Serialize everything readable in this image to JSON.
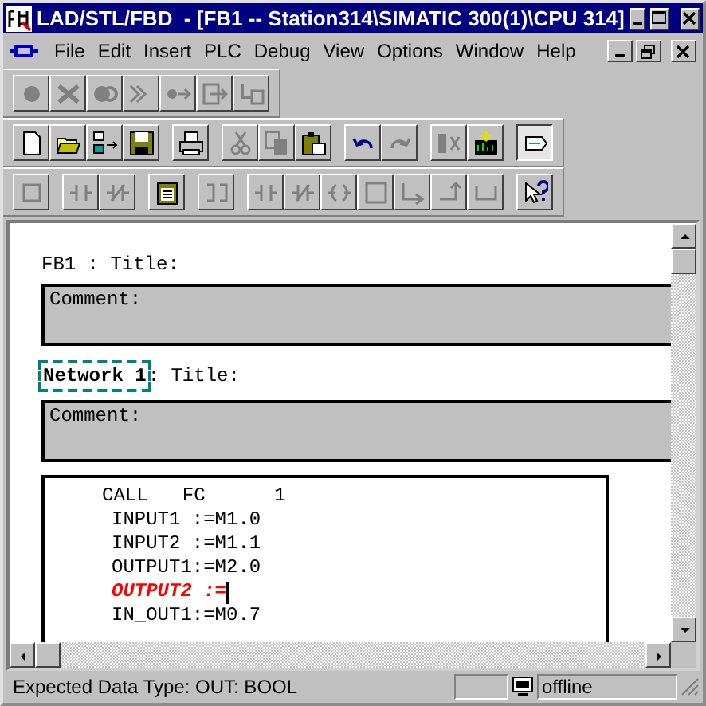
{
  "window": {
    "title": "LAD/STL/FBD  - [FB1 -- Station314\\SIMATIC 300(1)\\CPU 314]"
  },
  "menu": [
    {
      "label": "File"
    },
    {
      "label": "Edit"
    },
    {
      "label": "Insert"
    },
    {
      "label": "PLC"
    },
    {
      "label": "Debug"
    },
    {
      "label": "View"
    },
    {
      "label": "Options"
    },
    {
      "label": "Window"
    },
    {
      "label": "Help"
    }
  ],
  "toolbars": [
    {
      "groups": [
        [
          {
            "disabled": true
          },
          {
            "disabled": true
          },
          {
            "disabled": true
          },
          {
            "disabled": true
          },
          {
            "disabled": true
          },
          {
            "disabled": true
          },
          {
            "disabled": true
          }
        ]
      ]
    },
    {
      "groups": [
        [
          {
            "disabled": false
          },
          {
            "disabled": false
          },
          {
            "disabled": false
          },
          {
            "disabled": false
          }
        ],
        [
          {
            "disabled": false
          }
        ],
        [
          {
            "disabled": true
          },
          {
            "disabled": true
          },
          {
            "disabled": false
          }
        ],
        [
          {
            "disabled": false
          },
          {
            "disabled": true
          }
        ],
        [
          {
            "disabled": true
          },
          {
            "disabled": false
          }
        ],
        [
          {
            "disabled": false,
            "pressed": true
          }
        ]
      ]
    },
    {
      "groups": [
        [
          {
            "disabled": true
          }
        ],
        [
          {
            "disabled": true
          },
          {
            "disabled": true
          }
        ],
        [
          {
            "disabled": false
          }
        ],
        [
          {
            "disabled": true
          }
        ],
        [
          {
            "disabled": true
          },
          {
            "disabled": true
          },
          {
            "disabled": true
          },
          {
            "disabled": true
          },
          {
            "disabled": true
          },
          {
            "disabled": true
          },
          {
            "disabled": true
          }
        ],
        [
          {
            "disabled": false
          }
        ]
      ]
    }
  ],
  "block": {
    "title": "FB1 : Title:",
    "comment_label": "Comment:"
  },
  "networks": [
    {
      "label": "Network 1",
      "focused": true,
      "title": ": Title:",
      "comment_label": "Comment:",
      "code": [
        {
          "text": "CALL   FC      1",
          "kind": "statement",
          "cursor": false
        },
        {
          "text": "INPUT1 :=M1.0",
          "kind": "parameter",
          "cursor": false
        },
        {
          "text": "INPUT2 :=M1.1",
          "kind": "parameter",
          "cursor": false
        },
        {
          "text": "OUTPUT1:=M2.0",
          "kind": "parameter",
          "cursor": false
        },
        {
          "text": "OUTPUT2 :=",
          "kind": "error",
          "cursor": true
        },
        {
          "text": "IN_OUT1:=M0.7",
          "kind": "parameter",
          "cursor": false
        }
      ]
    }
  ],
  "status_bar": {
    "message": "Expected Data Type: OUT: BOOL",
    "connection": "offline"
  }
}
